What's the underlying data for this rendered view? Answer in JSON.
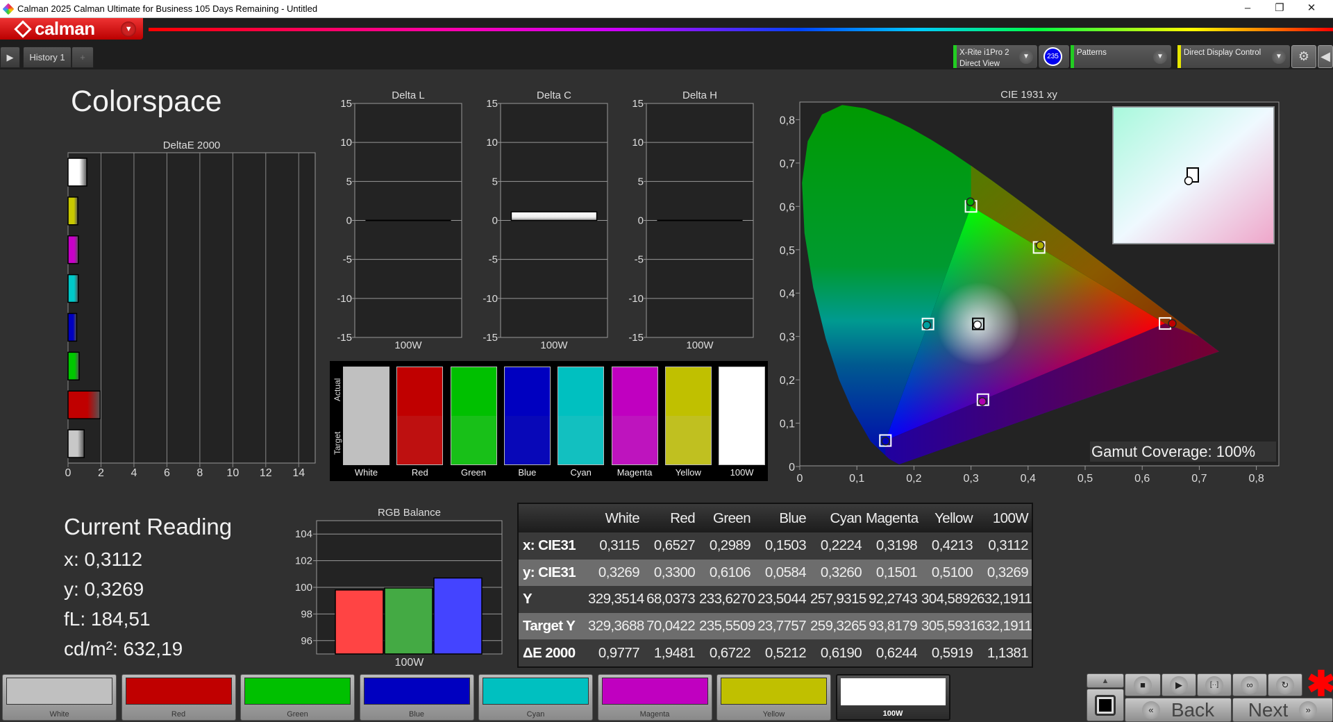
{
  "window": {
    "title": "Calman 2025 Calman Ultimate for Business 105 Days Remaining  - Untitled"
  },
  "logo": {
    "text": "calman"
  },
  "tabs": [
    {
      "label": "History 1"
    }
  ],
  "toolbar": {
    "meter": {
      "line1": "X-Rite i1Pro 2",
      "line2": "Direct View",
      "badge": "235",
      "status_color": "#22cc22"
    },
    "patterns": {
      "label": "Patterns",
      "status_color": "#22cc22"
    },
    "display_control": {
      "label": "Direct Display Control",
      "status_color": "#e6e600"
    },
    "badge_color": "#0000ee"
  },
  "page_title": "Colorspace",
  "current_reading": {
    "title": "Current Reading",
    "x": "x: 0,3112",
    "y": "y: 0,3269",
    "fl": "fL: 184,51",
    "cdm2": "cd/m²: 632,19"
  },
  "swatch_panel": {
    "actual_label": "Actual",
    "target_label": "Target",
    "items": [
      {
        "label": "White",
        "actual": "#c0c0c0",
        "target": "#c0c0c0"
      },
      {
        "label": "Red",
        "actual": "#c00000",
        "target": "#be1010"
      },
      {
        "label": "Green",
        "actual": "#00c000",
        "target": "#18c018"
      },
      {
        "label": "Blue",
        "actual": "#0000c0",
        "target": "#0808b8"
      },
      {
        "label": "Cyan",
        "actual": "#00c0c0",
        "target": "#12c0c0"
      },
      {
        "label": "Magenta",
        "actual": "#c000c0",
        "target": "#be14be"
      },
      {
        "label": "Yellow",
        "actual": "#c0c000",
        "target": "#c0c020"
      },
      {
        "label": "100W",
        "actual": "#ffffff",
        "target": "#ffffff"
      }
    ]
  },
  "table": {
    "columns": [
      "White",
      "Red",
      "Green",
      "Blue",
      "Cyan",
      "Magenta",
      "Yellow",
      "100W"
    ],
    "rows": [
      {
        "label": "x: CIE31",
        "values": [
          "0,3115",
          "0,6527",
          "0,2989",
          "0,1503",
          "0,2224",
          "0,3198",
          "0,4213",
          "0,3112"
        ]
      },
      {
        "label": "y: CIE31",
        "values": [
          "0,3269",
          "0,3300",
          "0,6106",
          "0,0584",
          "0,3260",
          "0,1501",
          "0,5100",
          "0,3269"
        ]
      },
      {
        "label": "Y",
        "values": [
          "329,3514",
          "68,0373",
          "233,6270",
          "23,5044",
          "257,9315",
          "92,2743",
          "304,5892",
          "632,1911"
        ]
      },
      {
        "label": "Target Y",
        "values": [
          "329,3688",
          "70,0422",
          "235,5509",
          "23,7757",
          "259,3265",
          "93,8179",
          "305,5931",
          "632,1911"
        ]
      },
      {
        "label": "ΔE 2000",
        "values": [
          "0,9777",
          "1,9481",
          "0,6722",
          "0,5212",
          "0,6190",
          "0,6244",
          "0,5919",
          "1,1381"
        ]
      }
    ]
  },
  "bottom_buttons": [
    {
      "label": "White",
      "color": "#c0c0c0"
    },
    {
      "label": "Red",
      "color": "#c00000"
    },
    {
      "label": "Green",
      "color": "#00c000"
    },
    {
      "label": "Blue",
      "color": "#0000c0"
    },
    {
      "label": "Cyan",
      "color": "#00c0c0"
    },
    {
      "label": "Magenta",
      "color": "#c000c0"
    },
    {
      "label": "Yellow",
      "color": "#c0c000"
    },
    {
      "label": "100W",
      "color": "#ffffff",
      "selected": true
    }
  ],
  "controls": {
    "back": "Back",
    "next": "Next"
  },
  "chart_data": [
    {
      "id": "deltae",
      "type": "bar",
      "orientation": "horizontal",
      "title": "DeltaE 2000",
      "categories": [
        "100W",
        "Yellow",
        "Magenta",
        "Cyan",
        "Blue",
        "Green",
        "Red",
        "White"
      ],
      "values": [
        1.1381,
        0.5919,
        0.6244,
        0.619,
        0.5212,
        0.6722,
        1.9481,
        0.9777
      ],
      "colors": [
        "#ffffff",
        "#c8c800",
        "#c800c8",
        "#00c8c8",
        "#0000c0",
        "#00c800",
        "#c00000",
        "#c8c8c8"
      ],
      "xlim": [
        0,
        15
      ],
      "xticks": [
        0,
        2,
        4,
        6,
        8,
        10,
        12,
        14
      ],
      "xtick_labels": [
        "0",
        "2",
        "4",
        "6",
        "8",
        "10",
        "12",
        "14"
      ],
      "grid": true
    },
    {
      "id": "deltal",
      "type": "bar",
      "title": "Delta L",
      "categories": [
        "100W"
      ],
      "values": [
        0
      ],
      "ylim": [
        -15,
        15
      ],
      "yticks": [
        15,
        10,
        5,
        0,
        -5,
        -10,
        -15
      ],
      "ytick_labels": [
        "15",
        "10",
        "5",
        "0",
        "-5",
        "-10",
        "-15"
      ],
      "grid": true
    },
    {
      "id": "deltac",
      "type": "bar",
      "title": "Delta C",
      "categories": [
        "100W"
      ],
      "values": [
        1.1
      ],
      "ylim": [
        -15,
        15
      ],
      "yticks": [
        15,
        10,
        5,
        0,
        -5,
        -10,
        -15
      ],
      "ytick_labels": [
        "15",
        "10",
        "5",
        "0",
        "-5",
        "-10",
        "-15"
      ],
      "grid": true
    },
    {
      "id": "deltah",
      "type": "bar",
      "title": "Delta H",
      "categories": [
        "100W"
      ],
      "values": [
        0
      ],
      "ylim": [
        -15,
        15
      ],
      "yticks": [
        15,
        10,
        5,
        0,
        -5,
        -10,
        -15
      ],
      "ytick_labels": [
        "15",
        "10",
        "5",
        "0",
        "-5",
        "-10",
        "-15"
      ],
      "grid": true
    },
    {
      "id": "rgb",
      "type": "bar",
      "title": "RGB Balance",
      "categories": [
        "100W"
      ],
      "series": [
        {
          "values": [
            99.8
          ],
          "color": "#ff4444"
        },
        {
          "values": [
            99.95
          ],
          "color": "#44aa44"
        },
        {
          "values": [
            100.7
          ],
          "color": "#4444ff"
        }
      ],
      "ylim": [
        95,
        105
      ],
      "yticks": [
        104,
        102,
        100,
        98,
        96
      ],
      "ytick_labels": [
        "104",
        "102",
        "100",
        "98",
        "96"
      ],
      "grid": true
    },
    {
      "id": "cie",
      "type": "scatter",
      "title": "CIE 1931 xy",
      "xlim": [
        0,
        0.8
      ],
      "ylim": [
        0,
        0.8
      ],
      "xticks": [
        0,
        0.1,
        0.2,
        0.3,
        0.4,
        0.5,
        0.6,
        0.7,
        0.8
      ],
      "xtick_labels": [
        "0",
        "0,1",
        "0,2",
        "0,3",
        "0,4",
        "0,5",
        "0,6",
        "0,7",
        "0,8"
      ],
      "yticks": [
        0,
        0.1,
        0.2,
        0.3,
        0.4,
        0.5,
        0.6,
        0.7,
        0.8
      ],
      "ytick_labels": [
        "0",
        "0,1",
        "0,2",
        "0,3",
        "0,4",
        "0,5",
        "0,6",
        "0,7",
        "0,8"
      ],
      "measured": [
        {
          "name": "Red",
          "x": 0.6527,
          "y": 0.33,
          "color": "#c00000"
        },
        {
          "name": "Green",
          "x": 0.2989,
          "y": 0.6106,
          "color": "#00b000"
        },
        {
          "name": "Blue",
          "x": 0.1503,
          "y": 0.0584,
          "color": "#0000c0"
        },
        {
          "name": "Cyan",
          "x": 0.2224,
          "y": 0.326,
          "color": "#00a0a0"
        },
        {
          "name": "Magenta",
          "x": 0.3198,
          "y": 0.1501,
          "color": "#b000b0"
        },
        {
          "name": "Yellow",
          "x": 0.4213,
          "y": 0.51,
          "color": "#b0b000"
        },
        {
          "name": "White",
          "x": 0.3112,
          "y": 0.3269,
          "color": "#ffffff"
        }
      ],
      "targets": [
        {
          "name": "Red",
          "x": 0.64,
          "y": 0.33
        },
        {
          "name": "Green",
          "x": 0.3,
          "y": 0.6
        },
        {
          "name": "Blue",
          "x": 0.15,
          "y": 0.06
        },
        {
          "name": "Cyan",
          "x": 0.2246,
          "y": 0.3287
        },
        {
          "name": "Magenta",
          "x": 0.3209,
          "y": 0.1542
        },
        {
          "name": "Yellow",
          "x": 0.4193,
          "y": 0.5053
        },
        {
          "name": "White",
          "x": 0.3127,
          "y": 0.329
        }
      ],
      "gamut_coverage": "Gamut Coverage:  100%"
    }
  ]
}
